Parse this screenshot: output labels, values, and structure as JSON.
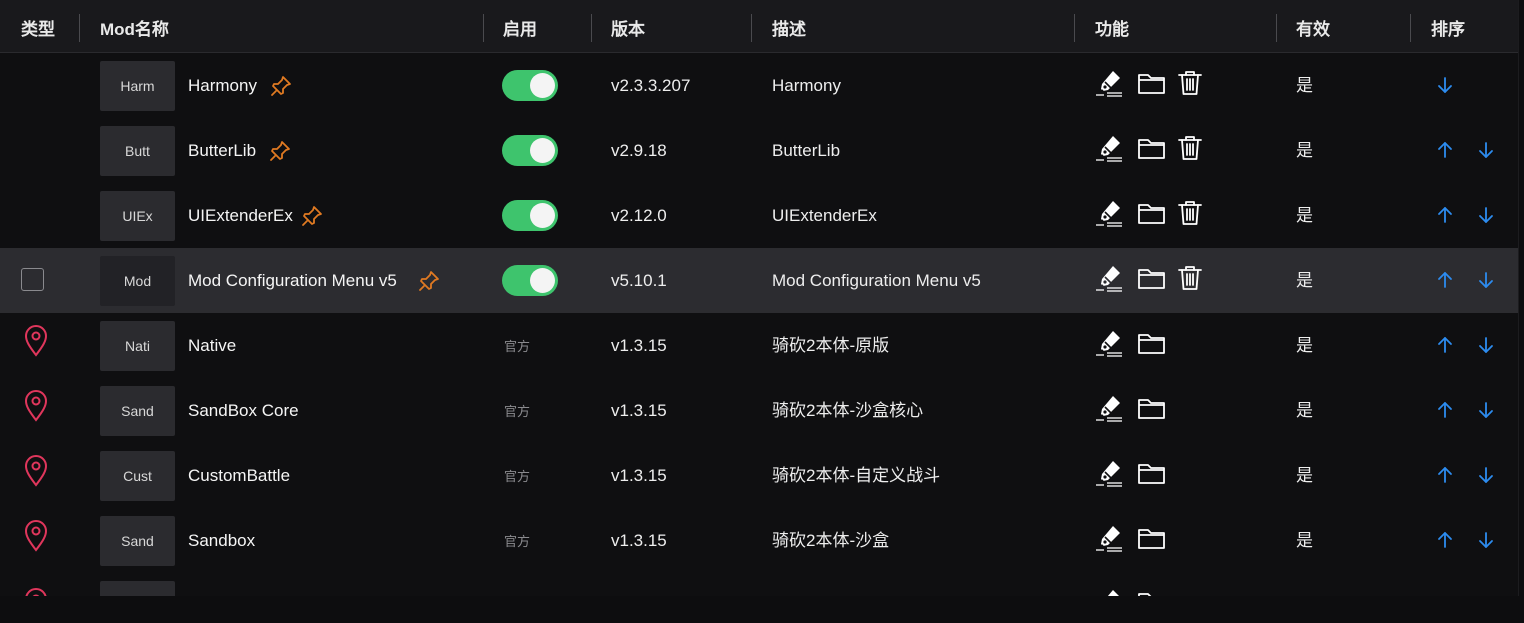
{
  "header": {
    "type": "类型",
    "mod_name": "Mod名称",
    "enabled": "启用",
    "version": "版本",
    "description": "描述",
    "functions": "功能",
    "valid": "有效",
    "order": "排序"
  },
  "colors": {
    "toggle_on": "#3ec46d",
    "pin": "#e07a22",
    "location": "#e0365c",
    "arrow": "#2d8cf0",
    "highlight_row": "#2c2c30"
  },
  "rows": [
    {
      "thumb": "Harm",
      "name": "Harmony",
      "version": "v2.3.3.207",
      "description": "Harmony",
      "valid": "是"
    },
    {
      "thumb": "Butt",
      "name": "ButterLib",
      "version": "v2.9.18",
      "description": "ButterLib",
      "valid": "是"
    },
    {
      "thumb": "UIEx",
      "name": "UIExtenderEx",
      "version": "v2.12.0",
      "description": "UIExtenderEx",
      "valid": "是"
    },
    {
      "thumb": "Mod",
      "name": "Mod Configuration Menu v5",
      "version": "v5.10.1",
      "description": "Mod Configuration Menu v5",
      "valid": "是"
    },
    {
      "thumb": "Nati",
      "name": "Native",
      "enabled_text": "官方",
      "version": "v1.3.15",
      "description": "骑砍2本体-原版",
      "valid": "是"
    },
    {
      "thumb": "Sand",
      "name": "SandBox Core",
      "enabled_text": "官方",
      "version": "v1.3.15",
      "description": "骑砍2本体-沙盒核心",
      "valid": "是"
    },
    {
      "thumb": "Cust",
      "name": "CustomBattle",
      "enabled_text": "官方",
      "version": "v1.3.15",
      "description": "骑砍2本体-自定义战斗",
      "valid": "是"
    },
    {
      "thumb": "Sand",
      "name": "Sandbox",
      "enabled_text": "官方",
      "version": "v1.3.15",
      "description": "骑砍2本体-沙盒",
      "valid": "是"
    }
  ],
  "icons": {
    "pin": "pin-icon",
    "edit": "pen-edit-icon",
    "folder": "folder-icon",
    "delete": "trash-icon",
    "location": "location-pin-icon",
    "up": "arrow-up-icon",
    "down": "arrow-down-icon"
  }
}
